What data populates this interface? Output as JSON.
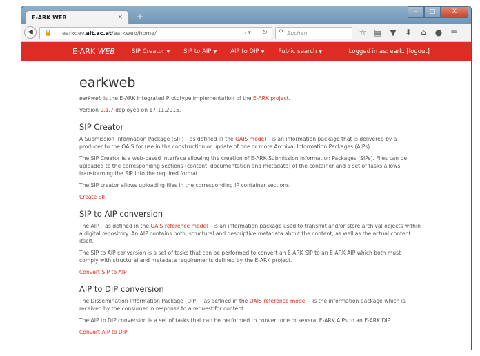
{
  "browser": {
    "tab_title": "E-ARK WEB",
    "tab_close": "×",
    "new_tab": "+",
    "url_prefix": "earkdev.",
    "url_host": "ait.ac.at",
    "url_path": "/earkweb/home/",
    "search_placeholder": "Suchen",
    "window_controls": [
      "–",
      "□",
      "X"
    ]
  },
  "navbar": {
    "brand_prefix": "E-ARK ",
    "brand_suffix": "WEB",
    "menu": [
      {
        "label": "SIP Creator"
      },
      {
        "label": "SIP to AIP"
      },
      {
        "label": "AIP to DIP"
      },
      {
        "label": "Public search"
      }
    ],
    "login_text": "Logged in as: eark.",
    "logout_label": "[logout]"
  },
  "content": {
    "title": "earkweb",
    "intro_em": "earkweb",
    "intro_text": " is the E-ARK Integrated Prototype implementation of the ",
    "intro_link": "E-ARK project",
    "intro_end": ".",
    "version_prefix": "Version ",
    "version": "0.1.7",
    "version_suffix": " deployed on 17.11.2015.",
    "sections": [
      {
        "heading": "SIP Creator",
        "p1_before": "A Submission Information Package (SIP) – as defined in the ",
        "p1_link": "OAIS model",
        "p1_after": " – is an information package that is delivered by a producer to the OAIS for use in the construction or update of one or more Archival Information Packages (AIPs).",
        "p2": "The SIP Creator is a web-based interface allowing the creation of E-ARK Submission Information Packages (SIPs). Files can be uploaded to the corresponding sections (content, documentation and metadata) of the container and a set of tasks allows transforming the SIP into the required format.",
        "p3": "The SIP creator allows uploading files in the corresponding IP container sections.",
        "action": "Create SIP"
      },
      {
        "heading": "SIP to AIP conversion",
        "p1_before": "The AIP – as defined in the ",
        "p1_link": "OAIS reference model",
        "p1_after": " – is an information package used to transmit and/or store archival objects within a digital repository. An AIP contains both, structural and descriptive metadata about the content, as well as the actual content itself.",
        "p2": "The SIP to AIP conversion is a set of tasks that can be performed to convert an E-ARK SIP to an E-ARK AIP which both must comply with structural and metadata requirements defined by the E-ARK project.",
        "action": "Convert SIP to AIP"
      },
      {
        "heading": "AIP to DIP conversion",
        "p1_before": "The Dissemination Information Package (DIP) – as defined in the ",
        "p1_link": "OAIS reference model",
        "p1_after": " – is the information package which is received by the consumer in response to a request for content.",
        "p2": "The AIP to DIP conversion is a set of tasks that can be performed to convert one or several E-ARK AIPs to an E-ARK DIP.",
        "action": "Convert AIP to DIP"
      }
    ]
  }
}
